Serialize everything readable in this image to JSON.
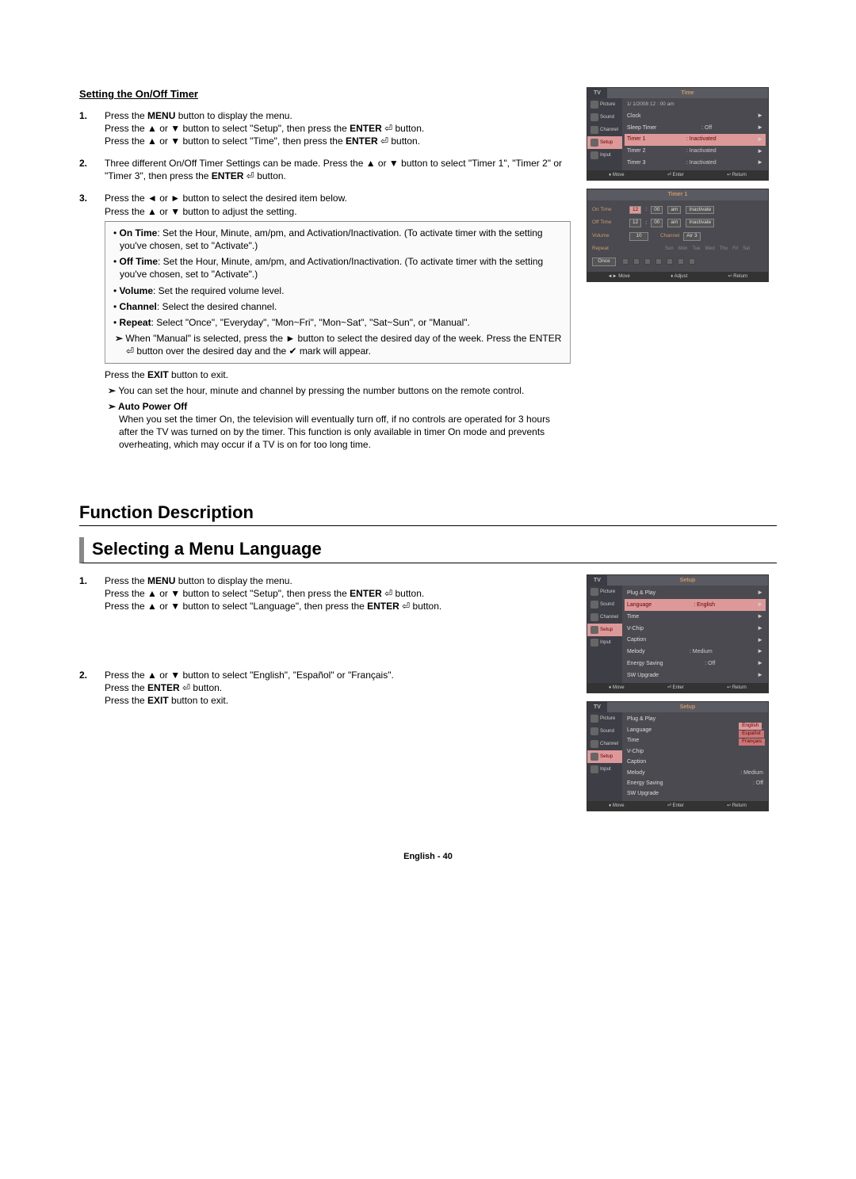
{
  "section1": {
    "title": "Setting the On/Off Timer",
    "steps": [
      {
        "num": "1.",
        "parts": [
          [
            "Press the ",
            "MENU",
            " button to display the menu."
          ],
          [
            "Press the ▲ or ▼ button to select \"Setup\", then press the ",
            "ENTER",
            " ⏎ button."
          ],
          [
            "Press the ▲ or ▼ button to select \"Time\", then press the ",
            "ENTER",
            " ⏎ button."
          ]
        ]
      },
      {
        "num": "2.",
        "parts": [
          [
            "Three different On/Off Timer Settings can be made. Press the ▲ or ▼ button to select \"Timer 1\", \"Timer 2\" or \"Timer 3\", then press the ",
            "ENTER",
            " ⏎ button."
          ]
        ]
      },
      {
        "num": "3.",
        "parts": [
          [
            "Press the ◄ or ► button to select the desired item below."
          ],
          [
            "Press the ▲ or ▼ button to adjust the setting."
          ]
        ],
        "box": {
          "items": [
            {
              "b": "On Time",
              "t": ": Set the Hour, Minute, am/pm, and Activation/Inactivation. (To activate timer with the setting you've chosen, set to \"Activate\".)"
            },
            {
              "b": "Off Time",
              "t": ": Set the Hour, Minute, am/pm, and Activation/Inactivation. (To activate timer with the setting you've chosen, set to \"Activate\".)"
            },
            {
              "b": "Volume",
              "t": ": Set the required volume level."
            },
            {
              "b": "Channel",
              "t": ": Select the desired channel."
            },
            {
              "b": "Repeat",
              "t": ": Select \"Once\", \"Everyday\", \"Mon~Fri\", \"Mon~Sat\", \"Sat~Sun\", or \"Manual\"."
            }
          ],
          "subnote": "When \"Manual\" is selected, press the ► button to select the desired day of the week. Press the ENTER ⏎ button over the desired day and the ✔ mark will appear."
        },
        "after": [
          [
            "Press the ",
            "EXIT",
            " button to exit."
          ]
        ],
        "notes": [
          "You can set the hour, minute and channel by pressing the number buttons on the remote control."
        ],
        "auto": {
          "title": "Auto Power Off",
          "text": "When you set the timer On, the television will eventually turn off, if no controls are operated for 3 hours after the TV was turned on by the timer. This function is only available in timer On mode and prevents overheating, which may occur if a TV is on for too long time."
        }
      }
    ],
    "osd_time": {
      "tv": "TV",
      "title": "Time",
      "side": [
        "Picture",
        "Sound",
        "Channel",
        "Setup",
        "Input"
      ],
      "date": "1/  1/2008  12 : 00 am",
      "rows": [
        {
          "lab": "Clock",
          "val": "",
          "arr": "►"
        },
        {
          "lab": "Sleep Timer",
          "val": ": Off",
          "arr": "►"
        },
        {
          "lab": "Timer 1",
          "val": ": Inactivated",
          "arr": "►",
          "sel": true
        },
        {
          "lab": "Timer 2",
          "val": ": Inactivated",
          "arr": "►"
        },
        {
          "lab": "Timer 3",
          "val": ": Inactivated",
          "arr": "►"
        }
      ],
      "foot": [
        "♦ Move",
        "⏎ Enter",
        "↩ Return"
      ]
    },
    "osd_timer1": {
      "title": "Timer 1",
      "rows": {
        "ontime": {
          "lbl": "On Time",
          "h": "12",
          "m": "00",
          "ap": "am",
          "act": "Inactivate"
        },
        "offtime": {
          "lbl": "Off Time",
          "h": "12",
          "m": "00",
          "ap": "am",
          "act": "Inactivate"
        },
        "vol": {
          "lbl": "Volume",
          "v": "10",
          "clbl": "Channel",
          "cv": "Air  3"
        },
        "repeat": {
          "lbl": "Repeat",
          "days": [
            "Sun",
            "Mon",
            "Tue",
            "Wed",
            "Thu",
            "Fri",
            "Sat"
          ],
          "once": "Once"
        }
      },
      "foot": [
        "◄► Move",
        "♦ Adjust",
        "↩ Return"
      ]
    }
  },
  "section2": {
    "fd_title": "Function Description",
    "sub_title": "Selecting a Menu Language",
    "steps": [
      {
        "num": "1.",
        "parts": [
          [
            "Press the ",
            "MENU",
            " button to display the menu."
          ],
          [
            "Press the ▲ or ▼ button to select \"Setup\", then press the ",
            "ENTER",
            " ⏎ button."
          ],
          [
            "Press the ▲ or ▼ button to select \"Language\", then press the ",
            "ENTER",
            " ⏎ button."
          ]
        ]
      },
      {
        "num": "2.",
        "parts": [
          [
            "Press the ▲ or ▼ button to select \"English\", \"Español\" or \"Français\"."
          ],
          [
            "Press the ",
            "ENTER",
            " ⏎ button."
          ],
          [
            "Press the ",
            "EXIT",
            " button to exit."
          ]
        ]
      }
    ],
    "osd_setup1": {
      "tv": "TV",
      "title": "Setup",
      "side": [
        "Picture",
        "Sound",
        "Channel",
        "Setup",
        "Input"
      ],
      "rows": [
        {
          "lab": "Plug & Play",
          "val": "",
          "arr": "►"
        },
        {
          "lab": "Language",
          "val": ": English",
          "arr": "►",
          "sel": true
        },
        {
          "lab": "Time",
          "val": "",
          "arr": "►"
        },
        {
          "lab": "V-Chip",
          "val": "",
          "arr": "►"
        },
        {
          "lab": "Caption",
          "val": "",
          "arr": "►"
        },
        {
          "lab": "Melody",
          "val": ": Medium",
          "arr": "►"
        },
        {
          "lab": "Energy Saving",
          "val": ": Off",
          "arr": "►"
        },
        {
          "lab": "SW Upgrade",
          "val": "",
          "arr": "►"
        }
      ],
      "foot": [
        "♦ Move",
        "⏎ Enter",
        "↩ Return"
      ]
    },
    "osd_setup2": {
      "tv": "TV",
      "title": "Setup",
      "side": [
        "Picture",
        "Sound",
        "Channel",
        "Setup",
        "Input"
      ],
      "rows": [
        {
          "lab": "Plug & Play",
          "val": ""
        },
        {
          "lab": "Language",
          "val": ":",
          "drop": [
            "English",
            "Español",
            "Français"
          ]
        },
        {
          "lab": "Time",
          "val": ""
        },
        {
          "lab": "V-Chip",
          "val": ""
        },
        {
          "lab": "Caption",
          "val": ""
        },
        {
          "lab": "Melody",
          "val": ": Medium"
        },
        {
          "lab": "Energy Saving",
          "val": ": Off"
        },
        {
          "lab": "SW Upgrade",
          "val": ""
        }
      ],
      "foot": [
        "♦ Move",
        "⏎ Enter",
        "↩ Return"
      ]
    }
  },
  "footer": "English - 40"
}
